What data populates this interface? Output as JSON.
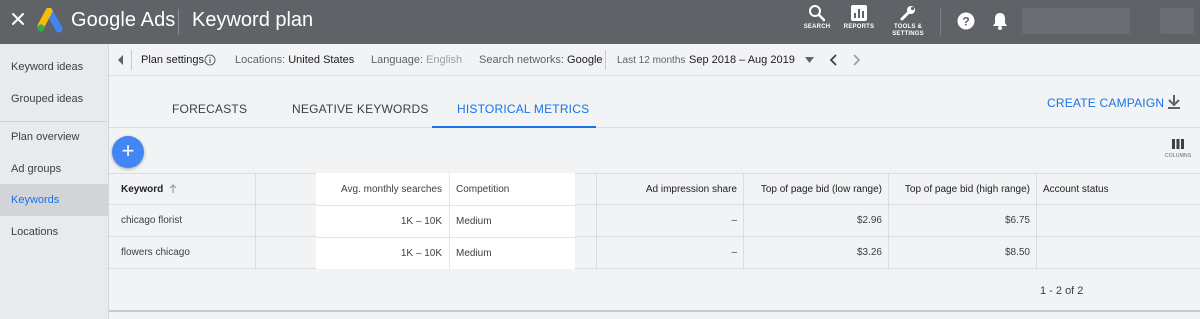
{
  "app": {
    "brand": "Google Ads",
    "page_title": "Keyword plan",
    "toolbar": {
      "search_label": "SEARCH",
      "reports_label": "REPORTS",
      "tools_label_1": "TOOLS &",
      "tools_label_2": "SETTINGS"
    },
    "colors": {
      "accent": "#1a73e8",
      "topbar": "#5f6368",
      "fab": "#4285f4"
    }
  },
  "sidebar": {
    "items": [
      {
        "label": "Keyword ideas",
        "active": false
      },
      {
        "label": "Grouped ideas",
        "active": false
      },
      {
        "label": "Plan overview",
        "active": false
      },
      {
        "label": "Ad groups",
        "active": false
      },
      {
        "label": "Keywords",
        "active": true
      },
      {
        "label": "Locations",
        "active": false
      }
    ]
  },
  "settings_bar": {
    "plan_settings": "Plan settings",
    "locations_label": "Locations:",
    "locations_value": "United States",
    "language_label": "Language:",
    "language_value": "English",
    "networks_label": "Search networks:",
    "networks_value": "Google",
    "period_label": "Last 12 months",
    "date_range": "Sep 2018 – Aug 2019"
  },
  "tabs": [
    {
      "label": "FORECASTS",
      "active": false
    },
    {
      "label": "NEGATIVE KEYWORDS",
      "active": false
    },
    {
      "label": "HISTORICAL METRICS",
      "active": true
    }
  ],
  "actions": {
    "create_campaign": "CREATE CAMPAIGN",
    "columns_label": "COLUMNS"
  },
  "table": {
    "headers": {
      "keyword": "Keyword",
      "avg_searches": "Avg. monthly searches",
      "competition": "Competition",
      "impression_share": "Ad impression share",
      "bid_low": "Top of page bid (low range)",
      "bid_high": "Top of page bid (high range)",
      "account_status": "Account status"
    },
    "rows": [
      {
        "keyword": "chicago florist",
        "avg_searches": "1K – 10K",
        "competition": "Medium",
        "impression_share": "–",
        "bid_low": "$2.96",
        "bid_high": "$6.75",
        "account_status": ""
      },
      {
        "keyword": "flowers chicago",
        "avg_searches": "1K – 10K",
        "competition": "Medium",
        "impression_share": "–",
        "bid_low": "$3.26",
        "bid_high": "$8.50",
        "account_status": ""
      }
    ]
  },
  "pagination": "1 - 2 of 2"
}
